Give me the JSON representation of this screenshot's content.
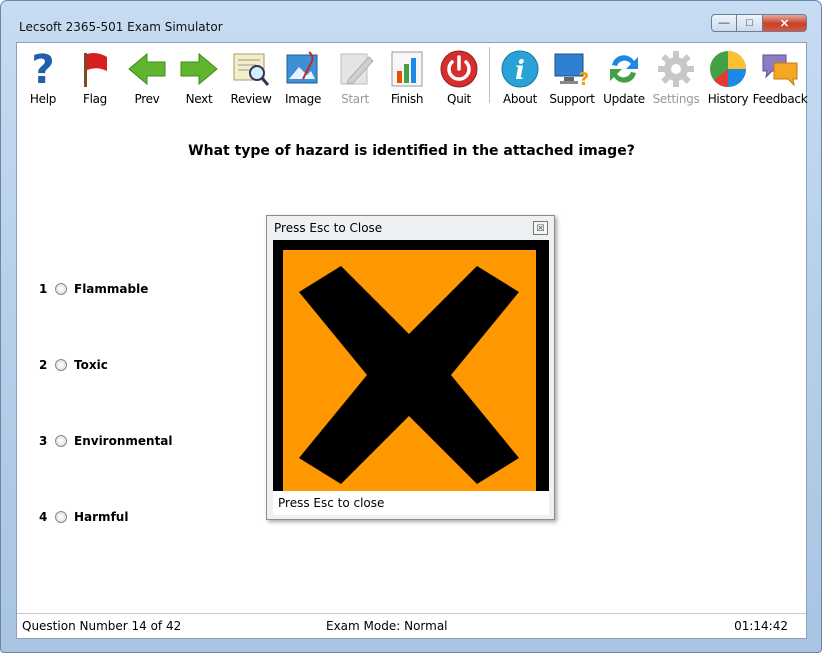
{
  "window": {
    "title": "Lecsoft 2365-501 Exam Simulator",
    "controls": [
      "minimize",
      "maximize",
      "close"
    ]
  },
  "toolbar": {
    "buttons": [
      {
        "label": "Help",
        "icon": "help-icon",
        "enabled": true
      },
      {
        "label": "Flag",
        "icon": "flag-icon",
        "enabled": true
      },
      {
        "label": "Prev",
        "icon": "prev-arrow-icon",
        "enabled": true
      },
      {
        "label": "Next",
        "icon": "next-arrow-icon",
        "enabled": true
      },
      {
        "label": "Review",
        "icon": "review-icon",
        "enabled": true
      },
      {
        "label": "Image",
        "icon": "image-icon",
        "enabled": true
      },
      {
        "label": "Start",
        "icon": "start-icon",
        "enabled": false
      },
      {
        "label": "Finish",
        "icon": "finish-icon",
        "enabled": true
      },
      {
        "label": "Quit",
        "icon": "power-icon",
        "enabled": true
      },
      {
        "label": "About",
        "icon": "info-icon",
        "enabled": true
      },
      {
        "label": "Support",
        "icon": "support-icon",
        "enabled": true
      },
      {
        "label": "Update",
        "icon": "update-icon",
        "enabled": true
      },
      {
        "label": "Settings",
        "icon": "gear-icon",
        "enabled": false
      },
      {
        "label": "History",
        "icon": "history-pie-icon",
        "enabled": true
      },
      {
        "label": "Feedback",
        "icon": "feedback-icon",
        "enabled": true
      }
    ]
  },
  "question": {
    "text": "What type of hazard is identified in the attached image?"
  },
  "answers": [
    {
      "number": "1",
      "label": "Flammable"
    },
    {
      "number": "2",
      "label": "Toxic"
    },
    {
      "number": "3",
      "label": "Environmental"
    },
    {
      "number": "4",
      "label": "Harmful"
    }
  ],
  "popup": {
    "title": "Press Esc to Close",
    "footer": "Press Esc to close",
    "image": "harmful-irritant-x-symbol",
    "colors": {
      "background": "#ff9800",
      "symbol": "#000000"
    }
  },
  "status": {
    "question_number": "Question Number 14 of 42",
    "exam_mode": "Exam Mode: Normal",
    "timer": "01:14:42"
  }
}
